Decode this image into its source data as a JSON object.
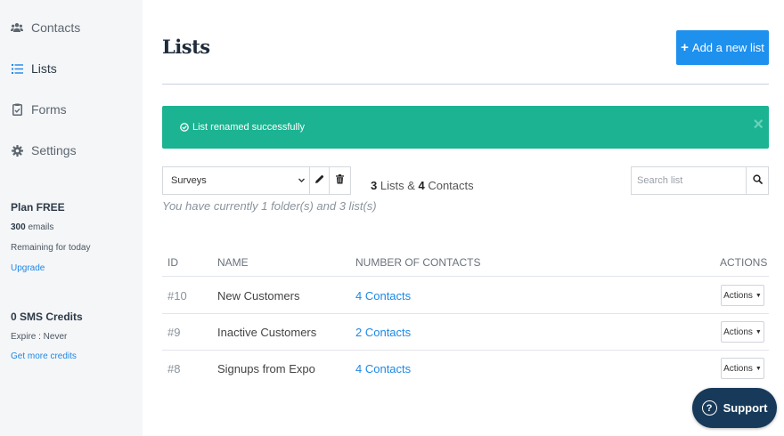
{
  "sidebar": {
    "items": [
      {
        "label": "Contacts",
        "icon": "users-icon"
      },
      {
        "label": "Lists",
        "icon": "list-icon",
        "active": true
      },
      {
        "label": "Forms",
        "icon": "clipboard-icon"
      },
      {
        "label": "Settings",
        "icon": "gear-icon"
      }
    ],
    "plan": {
      "title": "Plan FREE",
      "emails_count": "300",
      "emails_label": " emails",
      "remaining": "Remaining for today",
      "upgrade": "Upgrade"
    },
    "sms": {
      "title": "0 SMS Credits",
      "expire": "Expire : Never",
      "get_more": "Get more credits"
    }
  },
  "header": {
    "title": "Lists",
    "add_button": "Add a new list"
  },
  "alert": {
    "message": "List renamed successfully",
    "close": "×"
  },
  "toolbar": {
    "folder_selected": "Surveys",
    "folder_info": "You have currently 1 folder(s) and 3 list(s)",
    "summary": {
      "lists_count": "3",
      "lists_label": " Lists & ",
      "contacts_count": "4",
      "contacts_label": " Contacts"
    },
    "search_placeholder": "Search list"
  },
  "table": {
    "headers": {
      "id": "ID",
      "name": "NAME",
      "contacts": "NUMBER OF CONTACTS",
      "actions": "ACTIONS"
    },
    "rows": [
      {
        "id": "#10",
        "name": "New Customers",
        "contacts": "4 Contacts",
        "action": "Actions"
      },
      {
        "id": "#9",
        "name": "Inactive Customers",
        "contacts": "2 Contacts",
        "action": "Actions"
      },
      {
        "id": "#8",
        "name": "Signups from Expo",
        "contacts": "4 Contacts",
        "action": "Actions"
      }
    ]
  },
  "support": {
    "label": "Support"
  },
  "colors": {
    "primary": "#1e90ee",
    "success": "#1bb391",
    "link": "#1e88e5",
    "support": "#173a5a"
  }
}
